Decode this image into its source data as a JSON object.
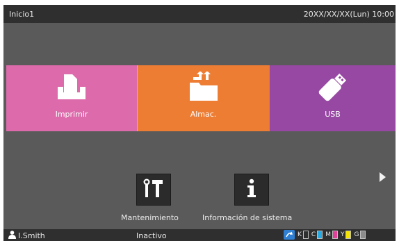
{
  "header": {
    "title": "Inicio1",
    "datetime": "20XX/XX/XX(Lun) 10:00"
  },
  "tiles": [
    {
      "label": "Imprimir",
      "icon": "print-tray-icon",
      "color": "#dd6aab"
    },
    {
      "label": "Almac.",
      "icon": "folder-store-icon",
      "color": "#ee7d34"
    },
    {
      "label": "USB",
      "icon": "usb-drive-icon",
      "color": "#9748a3"
    }
  ],
  "tools": [
    {
      "label": "Mantenimiento",
      "icon": "tools-icon"
    },
    {
      "label": "Información de sistema",
      "icon": "info-icon"
    }
  ],
  "footer": {
    "user": "I.Smith",
    "status": "Inactivo",
    "inks": [
      {
        "letter": "K",
        "color": "#2b2b2b",
        "level": 0.0
      },
      {
        "letter": "C",
        "color": "#27a9e1",
        "level": 1.0
      },
      {
        "letter": "M",
        "color": "#e0429a",
        "level": 1.0
      },
      {
        "letter": "Y",
        "color": "#f4e200",
        "level": 1.0
      },
      {
        "letter": "G",
        "color": "#8c8c8c",
        "level": 1.0
      }
    ]
  }
}
